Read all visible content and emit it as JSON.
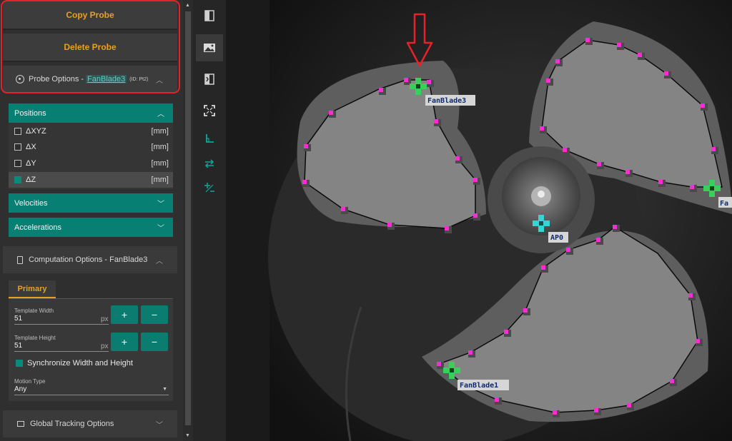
{
  "left_panel": {
    "copy_probe": "Copy Probe",
    "delete_probe": "Delete Probe",
    "probe_options": {
      "label": "Probe Options - ",
      "probe_name": "FanBlade3",
      "probe_id": "(ID: Pt2)"
    },
    "positions": {
      "header": "Positions",
      "rows": [
        {
          "label": "ΔXYZ",
          "unit": "[mm]",
          "checked": false
        },
        {
          "label": "ΔX",
          "unit": "[mm]",
          "checked": false
        },
        {
          "label": "ΔY",
          "unit": "[mm]",
          "checked": false
        },
        {
          "label": "ΔZ",
          "unit": "[mm]",
          "checked": true
        }
      ]
    },
    "velocities_header": "Velocities",
    "accelerations_header": "Accelerations",
    "computation_options": "Computation Options - FanBlade3",
    "primary_tab": "Primary",
    "template_width": {
      "label": "Template Width",
      "value": "51",
      "unit": "px"
    },
    "template_height": {
      "label": "Template Height",
      "value": "51",
      "unit": "px"
    },
    "plus": "+",
    "minus": "−",
    "sync_label": "Synchronize Width and Height",
    "motion_type": {
      "label": "Motion Type",
      "value": "Any"
    },
    "global_tracking": "Global Tracking Options"
  },
  "viewer": {
    "labels": {
      "fanblade3": "FanBlade3",
      "fanblade1": "FanBlade1",
      "ap0": "AP0",
      "fa_partial": "Fa"
    },
    "marker_color": "#ff2bd6",
    "probe_color": "#36d05a",
    "ap_color": "#39d3d3",
    "arrow_color": "#e5222a"
  },
  "icons": [
    "panel-left-icon",
    "image-icon",
    "panel-right-icon",
    "fit-screen-icon",
    "axis-icon",
    "swap-icon",
    "plus-minus-icon"
  ]
}
